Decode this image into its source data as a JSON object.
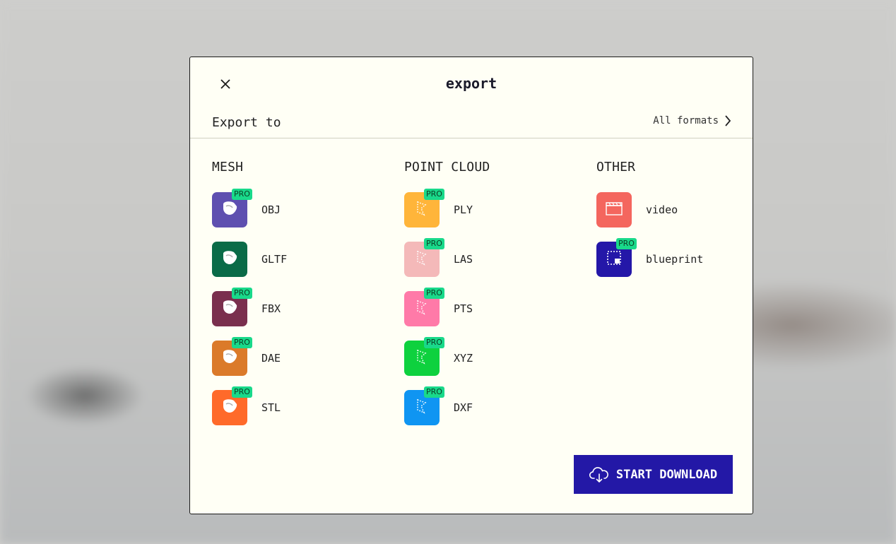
{
  "dialog": {
    "title": "export",
    "export_to": "Export to",
    "all_formats": "All formats",
    "download_label": "START DOWNLOAD"
  },
  "columns": [
    {
      "heading": "MESH",
      "items": [
        {
          "label": "OBJ",
          "color": "#5e4fb0",
          "pro": "PRO",
          "icon": "mesh-shape-icon"
        },
        {
          "label": "GLTF",
          "color": "#0a6b48",
          "pro": "",
          "icon": "mesh-shape-icon"
        },
        {
          "label": "FBX",
          "color": "#7a2f4e",
          "pro": "PRO",
          "icon": "mesh-shape-icon"
        },
        {
          "label": "DAE",
          "color": "#db7a2a",
          "pro": "PRO",
          "icon": "mesh-shape-icon"
        },
        {
          "label": "STL",
          "color": "#ff6a2a",
          "pro": "PRO",
          "icon": "mesh-shape-icon"
        }
      ]
    },
    {
      "heading": "POINT CLOUD",
      "items": [
        {
          "label": "PLY",
          "color": "#ffb53a",
          "pro": "PRO",
          "icon": "point-cloud-icon"
        },
        {
          "label": "LAS",
          "color": "#f4b9b9",
          "pro": "PRO",
          "icon": "point-cloud-icon"
        },
        {
          "label": "PTS",
          "color": "#ff7aa8",
          "pro": "PRO",
          "icon": "point-cloud-icon"
        },
        {
          "label": "XYZ",
          "color": "#0ed13e",
          "pro": "PRO",
          "icon": "point-cloud-icon"
        },
        {
          "label": "DXF",
          "color": "#0f95f2",
          "pro": "PRO",
          "icon": "point-cloud-icon"
        }
      ]
    },
    {
      "heading": "OTHER",
      "items": [
        {
          "label": "video",
          "color": "#f4665e",
          "pro": "",
          "icon": "clapperboard-icon"
        },
        {
          "label": "blueprint",
          "color": "#2417a8",
          "pro": "PRO",
          "icon": "blueprint-icon"
        }
      ]
    }
  ]
}
